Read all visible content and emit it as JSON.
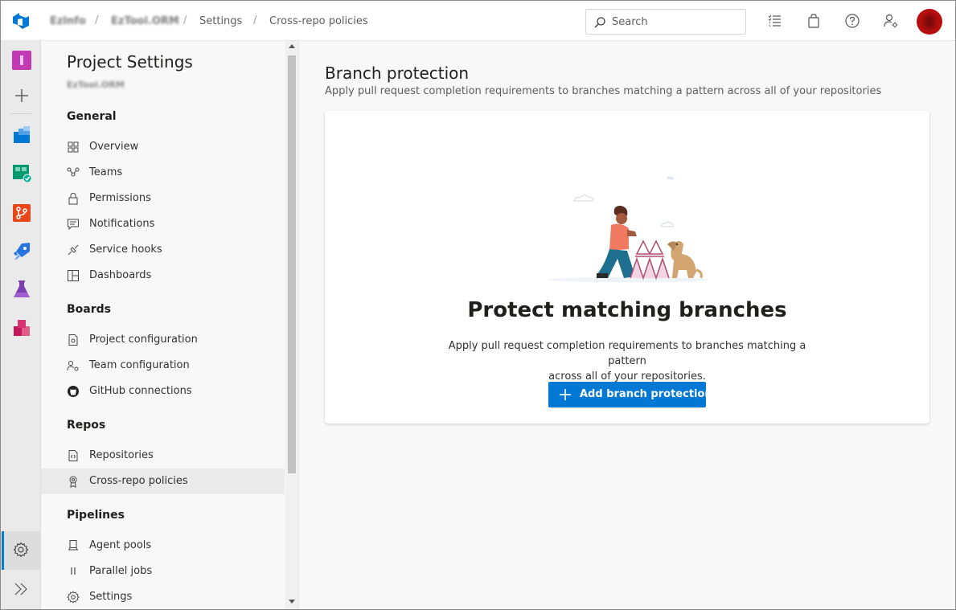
{
  "topbar": {
    "org": "Ezlnfo",
    "project": "EzTool.ORM",
    "crumb_settings": "Settings",
    "crumb_page": "Cross-repo policies",
    "search_placeholder": "Search"
  },
  "nav": {
    "title": "Project Settings",
    "subtitle": "EzTool.ORM",
    "groups": [
      {
        "label": "General",
        "items": [
          {
            "label": "Overview",
            "icon": "overview-icon"
          },
          {
            "label": "Teams",
            "icon": "teams-icon"
          },
          {
            "label": "Permissions",
            "icon": "lock-icon"
          },
          {
            "label": "Notifications",
            "icon": "chat-icon"
          },
          {
            "label": "Service hooks",
            "icon": "hook-icon"
          },
          {
            "label": "Dashboards",
            "icon": "dashboard-icon"
          }
        ]
      },
      {
        "label": "Boards",
        "items": [
          {
            "label": "Project configuration",
            "icon": "project-config-icon"
          },
          {
            "label": "Team configuration",
            "icon": "team-config-icon"
          },
          {
            "label": "GitHub connections",
            "icon": "github-icon"
          }
        ]
      },
      {
        "label": "Repos",
        "items": [
          {
            "label": "Repositories",
            "icon": "repo-icon"
          },
          {
            "label": "Cross-repo policies",
            "icon": "policy-icon"
          }
        ]
      },
      {
        "label": "Pipelines",
        "items": [
          {
            "label": "Agent pools",
            "icon": "agent-pool-icon"
          },
          {
            "label": "Parallel jobs",
            "icon": "parallel-icon"
          },
          {
            "label": "Settings",
            "icon": "gear-icon"
          }
        ]
      }
    ]
  },
  "main": {
    "title": "Branch protection",
    "subtitle": "Apply pull request completion requirements to branches matching a pattern across all of your repositories",
    "card_title": "Protect matching branches",
    "card_desc_line1": "Apply pull request completion requirements to branches matching a pattern",
    "card_desc_line2": "across all of your repositories.",
    "button_label": "Add branch protection"
  },
  "colors": {
    "accent": "#0078d4",
    "avatar": "#b80f0f"
  }
}
